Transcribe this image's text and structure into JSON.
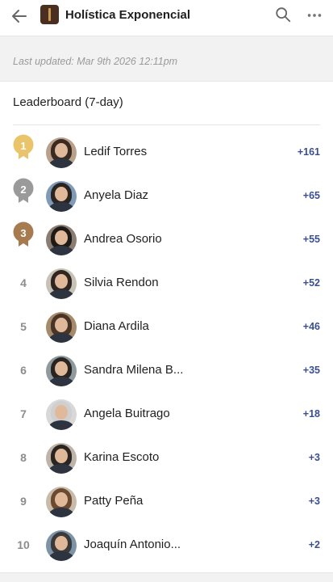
{
  "header": {
    "title": "Holística Exponencial",
    "back_icon": "arrow-left-icon",
    "search_icon": "search-icon",
    "more_icon": "more-horizontal-icon"
  },
  "status": {
    "last_updated": "Last updated: Mar 9th 2026 12:11pm"
  },
  "leaderboard": {
    "title": "Leaderboard (7-day)",
    "colors": {
      "gold": "#e9c46a",
      "silver": "#9a9a9a",
      "bronze": "#a67b50",
      "score": "#3b4f8f"
    },
    "rows": [
      {
        "rank": "1",
        "name": "Ledif Torres",
        "score": "+161"
      },
      {
        "rank": "2",
        "name": "Anyela Diaz",
        "score": "+65"
      },
      {
        "rank": "3",
        "name": "Andrea Osorio",
        "score": "+55"
      },
      {
        "rank": "4",
        "name": "Silvia Rendon",
        "score": "+52"
      },
      {
        "rank": "5",
        "name": "Diana Ardila",
        "score": "+46"
      },
      {
        "rank": "6",
        "name": "Sandra Milena B...",
        "score": "+35"
      },
      {
        "rank": "7",
        "name": "Angela Buitrago",
        "score": "+18"
      },
      {
        "rank": "8",
        "name": "Karina Escoto",
        "score": "+3"
      },
      {
        "rank": "9",
        "name": "Patty Peña",
        "score": "+3"
      },
      {
        "rank": "10",
        "name": "Joaquín Antonio...",
        "score": "+2"
      }
    ]
  }
}
